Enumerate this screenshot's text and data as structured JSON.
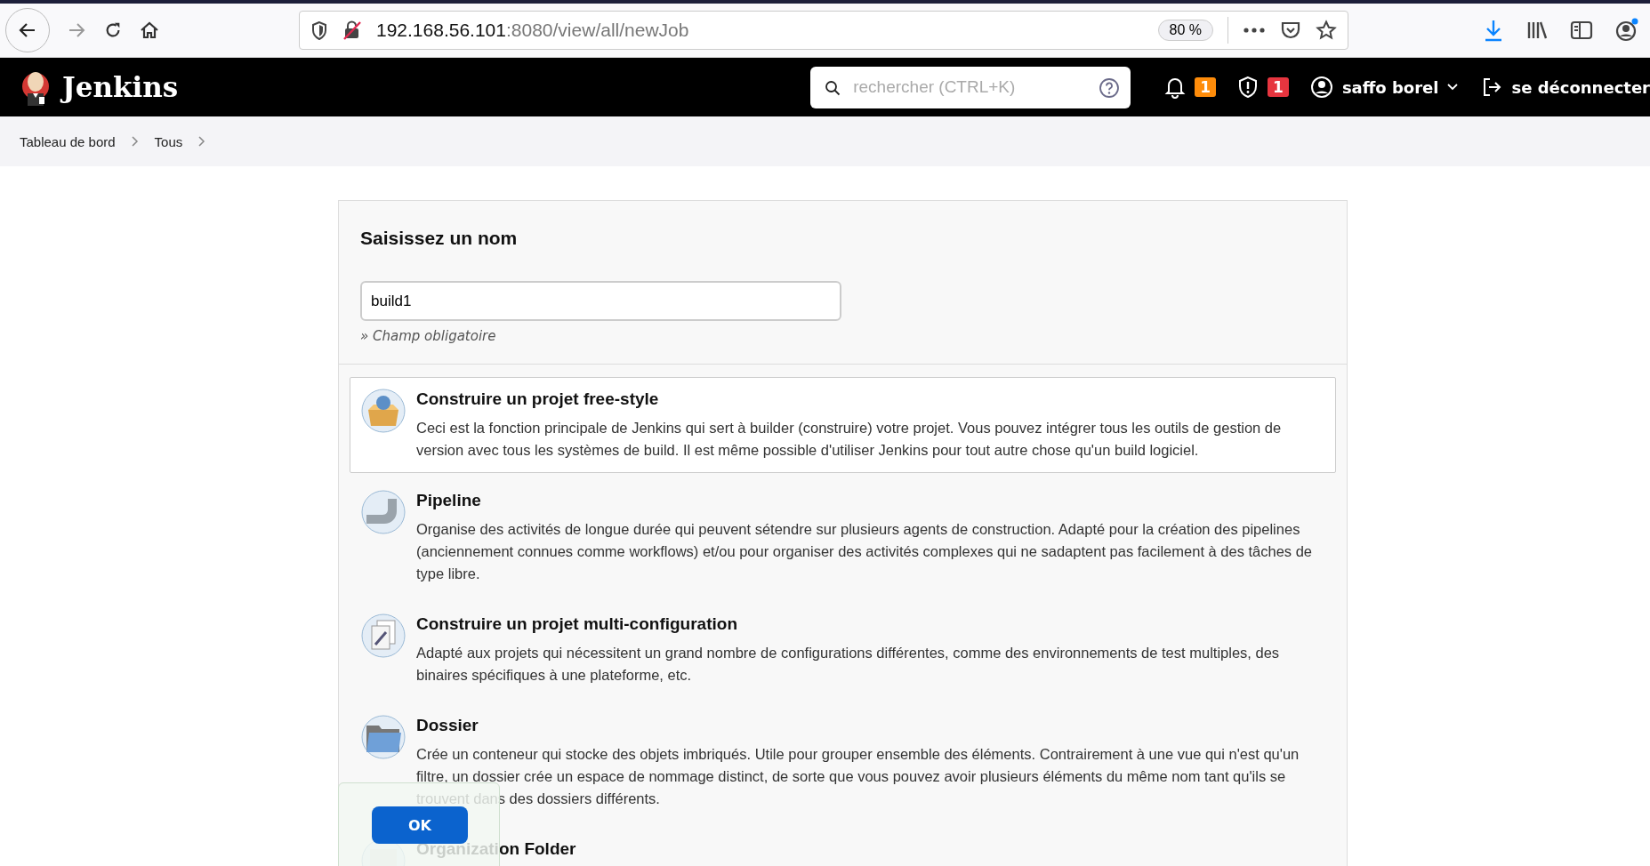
{
  "browser": {
    "url_host": "192.168.56.101",
    "url_path": ":8080/view/all/newJob",
    "zoom": "80 %"
  },
  "header": {
    "logo": "Jenkins",
    "search": {
      "placeholder": "rechercher (CTRL+K)"
    },
    "notifications": "1",
    "security": "1",
    "user": "saffo borel",
    "logout": "se déconnecter"
  },
  "breadcrumb": [
    "Tableau de bord",
    "Tous"
  ],
  "form": {
    "title": "Saisissez un nom",
    "name_field": {
      "value": "build1"
    },
    "hint": "» Champ obligatoire"
  },
  "items": [
    {
      "kind": "freestyle",
      "name": "Construire un projet free-style",
      "description": "Ceci est la fonction principale de Jenkins qui sert à builder (construire) votre projet. Vous pouvez intégrer tous les outils de gestion de version avec tous les systèmes de build. Il est même possible d'utiliser Jenkins pour tout autre chose qu'un build logiciel.",
      "selected": true
    },
    {
      "kind": "pipeline",
      "name": "Pipeline",
      "description": "Organise des activités de longue durée qui peuvent sétendre sur plusieurs agents de construction. Adapté pour la création des pipelines (anciennement connues comme workflows) et/ou pour organiser des activités complexes qui ne sadaptent pas facilement à des tâches de type libre.",
      "selected": false
    },
    {
      "kind": "multiconfig",
      "name": "Construire un projet multi-configuration",
      "description": "Adapté aux projets qui nécessitent un grand nombre de configurations différentes, comme des environnements de test multiples, des binaires spécifiques à une plateforme, etc.",
      "selected": false
    },
    {
      "kind": "folder",
      "name": "Dossier",
      "description": "Crée un conteneur qui stocke des objets imbriqués. Utile pour grouper ensemble des éléments. Contrairement à une vue qui n'est qu'un filtre, un dossier crée un espace de nommage distinct, de sorte que vous pouvez avoir plusieurs éléments du même nom tant qu'ils se trouvent dans des dossiers différents.",
      "selected": false
    },
    {
      "kind": "orgfolder",
      "name": "Organization Folder",
      "selected": false
    }
  ],
  "ok_button": "OK"
}
